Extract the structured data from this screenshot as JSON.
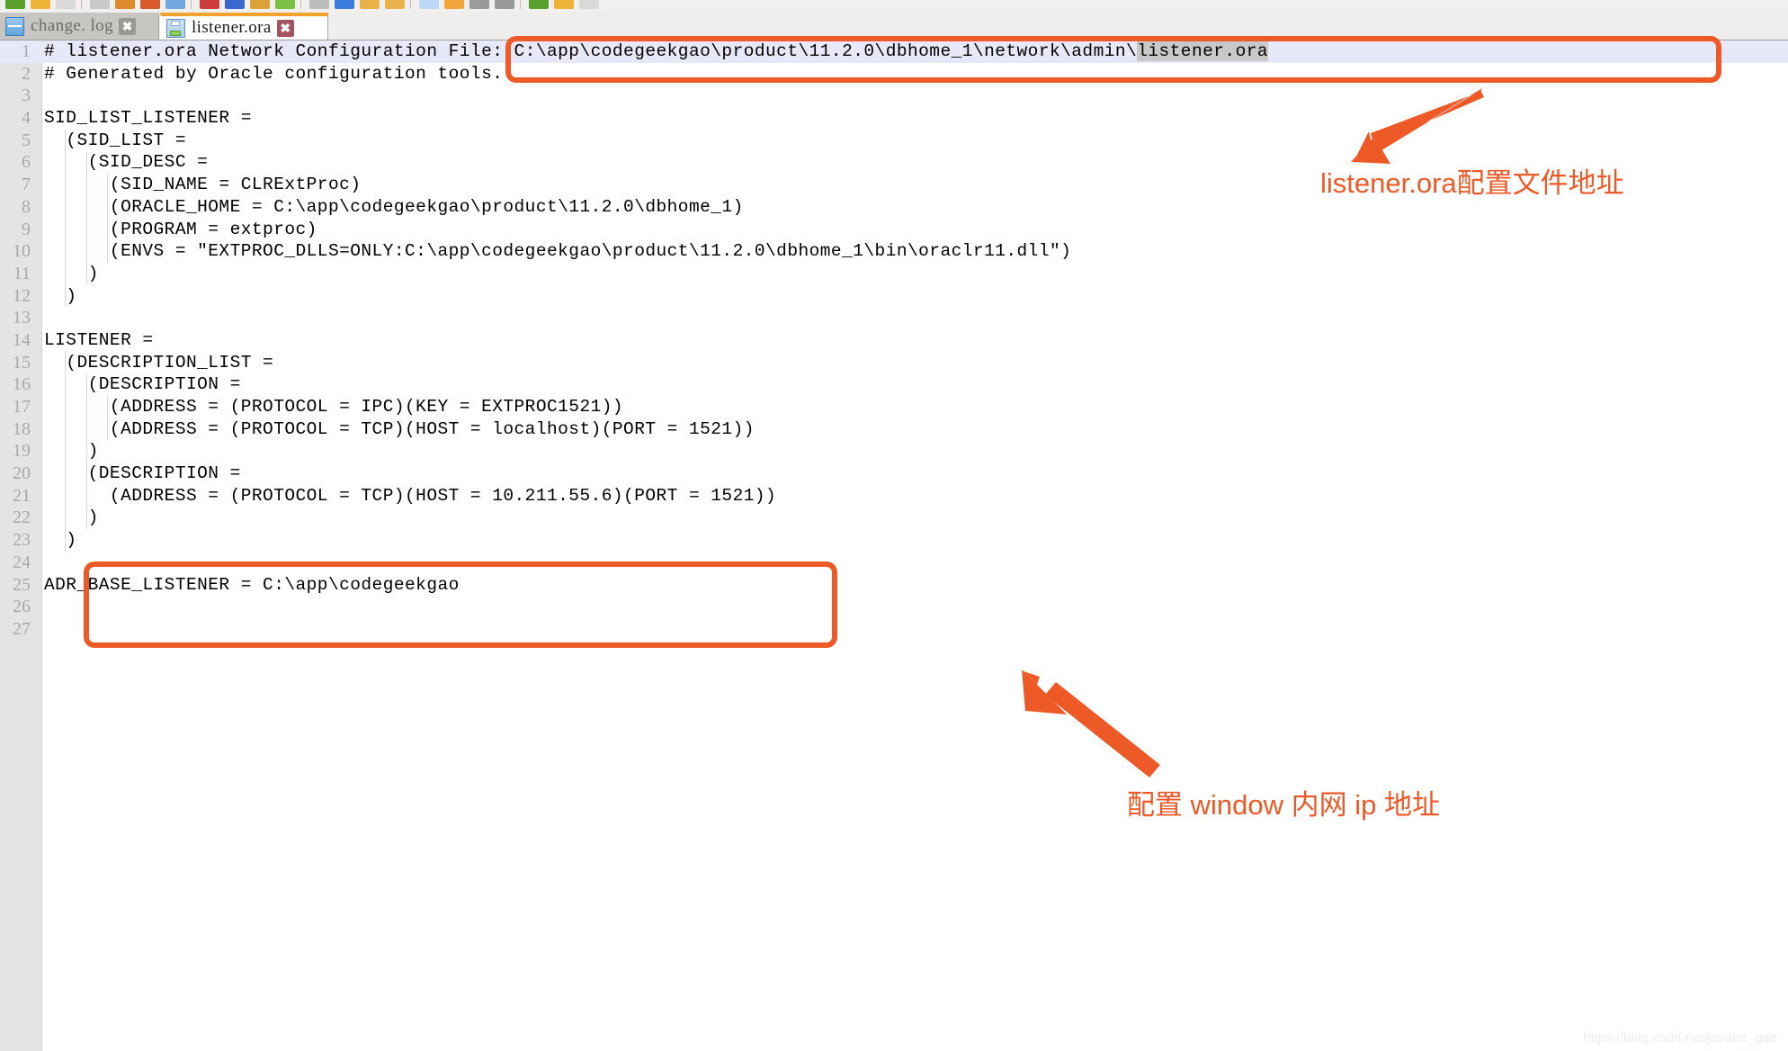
{
  "window": {
    "app": "text-editor",
    "toolbar_icons": [
      "new-file-icon",
      "open-folder-icon",
      "save-icon",
      "save-all-icon",
      "close-file-icon",
      "close-all-icon",
      "print-icon",
      "cut-icon",
      "copy-icon",
      "paste-icon",
      "undo-icon",
      "redo-icon",
      "find-icon",
      "replace-icon",
      "zoom-in-icon",
      "zoom-out-icon",
      "sync-scroll-icon",
      "word-wrap-icon",
      "show-symbol-icon",
      "indent-guide-icon",
      "record-macro-icon",
      "play-macro-icon"
    ]
  },
  "tabs": [
    {
      "label": "change. log",
      "icon": "blue-sheet-icon",
      "close_label": "✖",
      "active": false
    },
    {
      "label": "listener.ora",
      "icon": "floppy-save-icon",
      "close_label": "✖",
      "active": true
    }
  ],
  "editor": {
    "caret_line": 1,
    "selection_text": "listener.ora",
    "lines": [
      {
        "n": "1",
        "text": "# listener.ora Network Configuration File: C:\\app\\codegeekgao\\product\\11.2.0\\dbhome_1\\network\\admin\\",
        "highlight": true,
        "selected_suffix": "listener.ora",
        "caret": true
      },
      {
        "n": "2",
        "text": "# Generated by Oracle configuration tools."
      },
      {
        "n": "3",
        "text": ""
      },
      {
        "n": "4",
        "text": "SID_LIST_LISTENER ="
      },
      {
        "n": "5",
        "text": "  (SID_LIST ="
      },
      {
        "n": "6",
        "text": "    (SID_DESC ="
      },
      {
        "n": "7",
        "text": "      (SID_NAME = CLRExtProc)"
      },
      {
        "n": "8",
        "text": "      (ORACLE_HOME = C:\\app\\codegeekgao\\product\\11.2.0\\dbhome_1)"
      },
      {
        "n": "9",
        "text": "      (PROGRAM = extproc)"
      },
      {
        "n": "10",
        "text": "      (ENVS = \"EXTPROC_DLLS=ONLY:C:\\app\\codegeekgao\\product\\11.2.0\\dbhome_1\\bin\\oraclr11.dll\")"
      },
      {
        "n": "11",
        "text": "    )"
      },
      {
        "n": "12",
        "text": "  )"
      },
      {
        "n": "13",
        "text": ""
      },
      {
        "n": "14",
        "text": "LISTENER ="
      },
      {
        "n": "15",
        "text": "  (DESCRIPTION_LIST ="
      },
      {
        "n": "16",
        "text": "    (DESCRIPTION ="
      },
      {
        "n": "17",
        "text": "      (ADDRESS = (PROTOCOL = IPC)(KEY = EXTPROC1521))"
      },
      {
        "n": "18",
        "text": "      (ADDRESS = (PROTOCOL = TCP)(HOST = localhost)(PORT = 1521))"
      },
      {
        "n": "19",
        "text": "    )"
      },
      {
        "n": "20",
        "text": "    (DESCRIPTION ="
      },
      {
        "n": "21",
        "text": "      (ADDRESS = (PROTOCOL = TCP)(HOST = 10.211.55.6)(PORT = 1521))"
      },
      {
        "n": "22",
        "text": "    )"
      },
      {
        "n": "23",
        "text": "  )"
      },
      {
        "n": "24",
        "text": ""
      },
      {
        "n": "25",
        "text": "ADR_BASE_LISTENER = C:\\app\\codegeekgao"
      },
      {
        "n": "26",
        "text": ""
      },
      {
        "n": "27",
        "text": ""
      }
    ]
  },
  "annotations": [
    {
      "id": "annotation-file-path",
      "text": "listener.ora配置文件地址",
      "color": "#ed5a28"
    },
    {
      "id": "annotation-internal-ip",
      "text": "配置 window 内网 ip 地址",
      "color": "#ed5a28"
    }
  ],
  "highlight_boxes": [
    {
      "id": "highlight-box-file-path",
      "color": "#ed5a28"
    },
    {
      "id": "highlight-box-description",
      "color": "#ed5a28"
    }
  ],
  "watermark": {
    "text": "https://blog.csdn.net/javaee_gao"
  }
}
